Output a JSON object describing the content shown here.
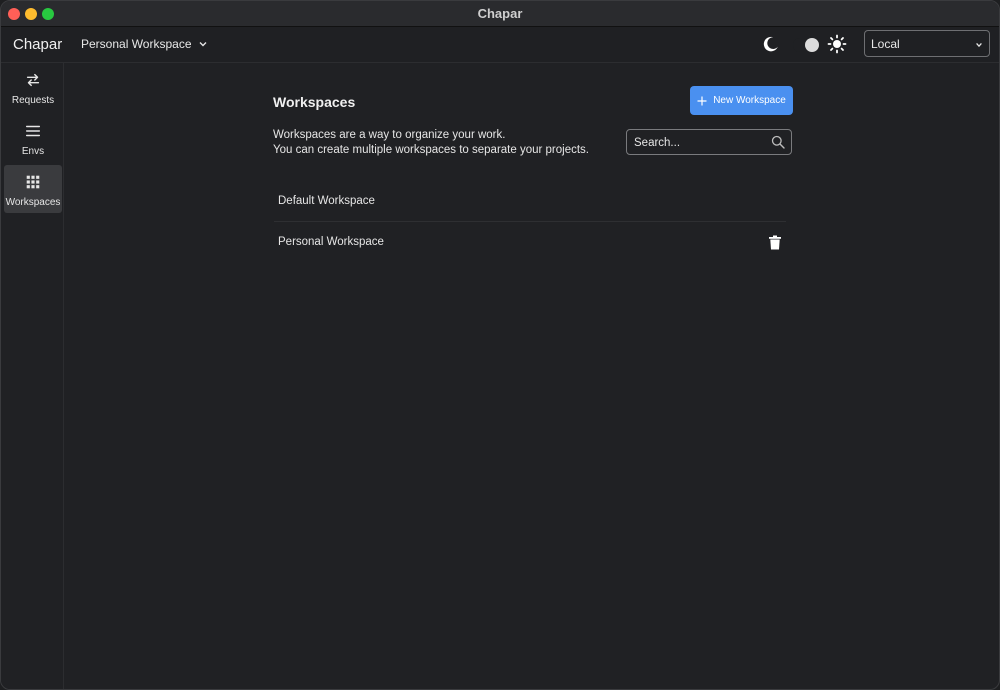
{
  "window": {
    "title": "Chapar"
  },
  "header": {
    "app_name": "Chapar",
    "workspace_selector": "Personal Workspace",
    "environment_selector": "Local"
  },
  "sidebar": {
    "items": [
      {
        "label": "Requests",
        "icon": "swap-arrows-icon",
        "active": false
      },
      {
        "label": "Envs",
        "icon": "menu-lines-icon",
        "active": false
      },
      {
        "label": "Workspaces",
        "icon": "grid-icon",
        "active": true
      }
    ]
  },
  "main": {
    "title": "Workspaces",
    "new_button_label": "New Workspace",
    "description_line1": "Workspaces are a way to organize your work.",
    "description_line2": "You can create multiple workspaces to separate your projects.",
    "search_placeholder": "Search...",
    "workspaces": [
      {
        "name": "Default Workspace",
        "deletable": false
      },
      {
        "name": "Personal Workspace",
        "deletable": true
      }
    ]
  },
  "colors": {
    "accent": "#4a90f0",
    "background": "#202124",
    "active_nav": "#3a3b3e"
  }
}
